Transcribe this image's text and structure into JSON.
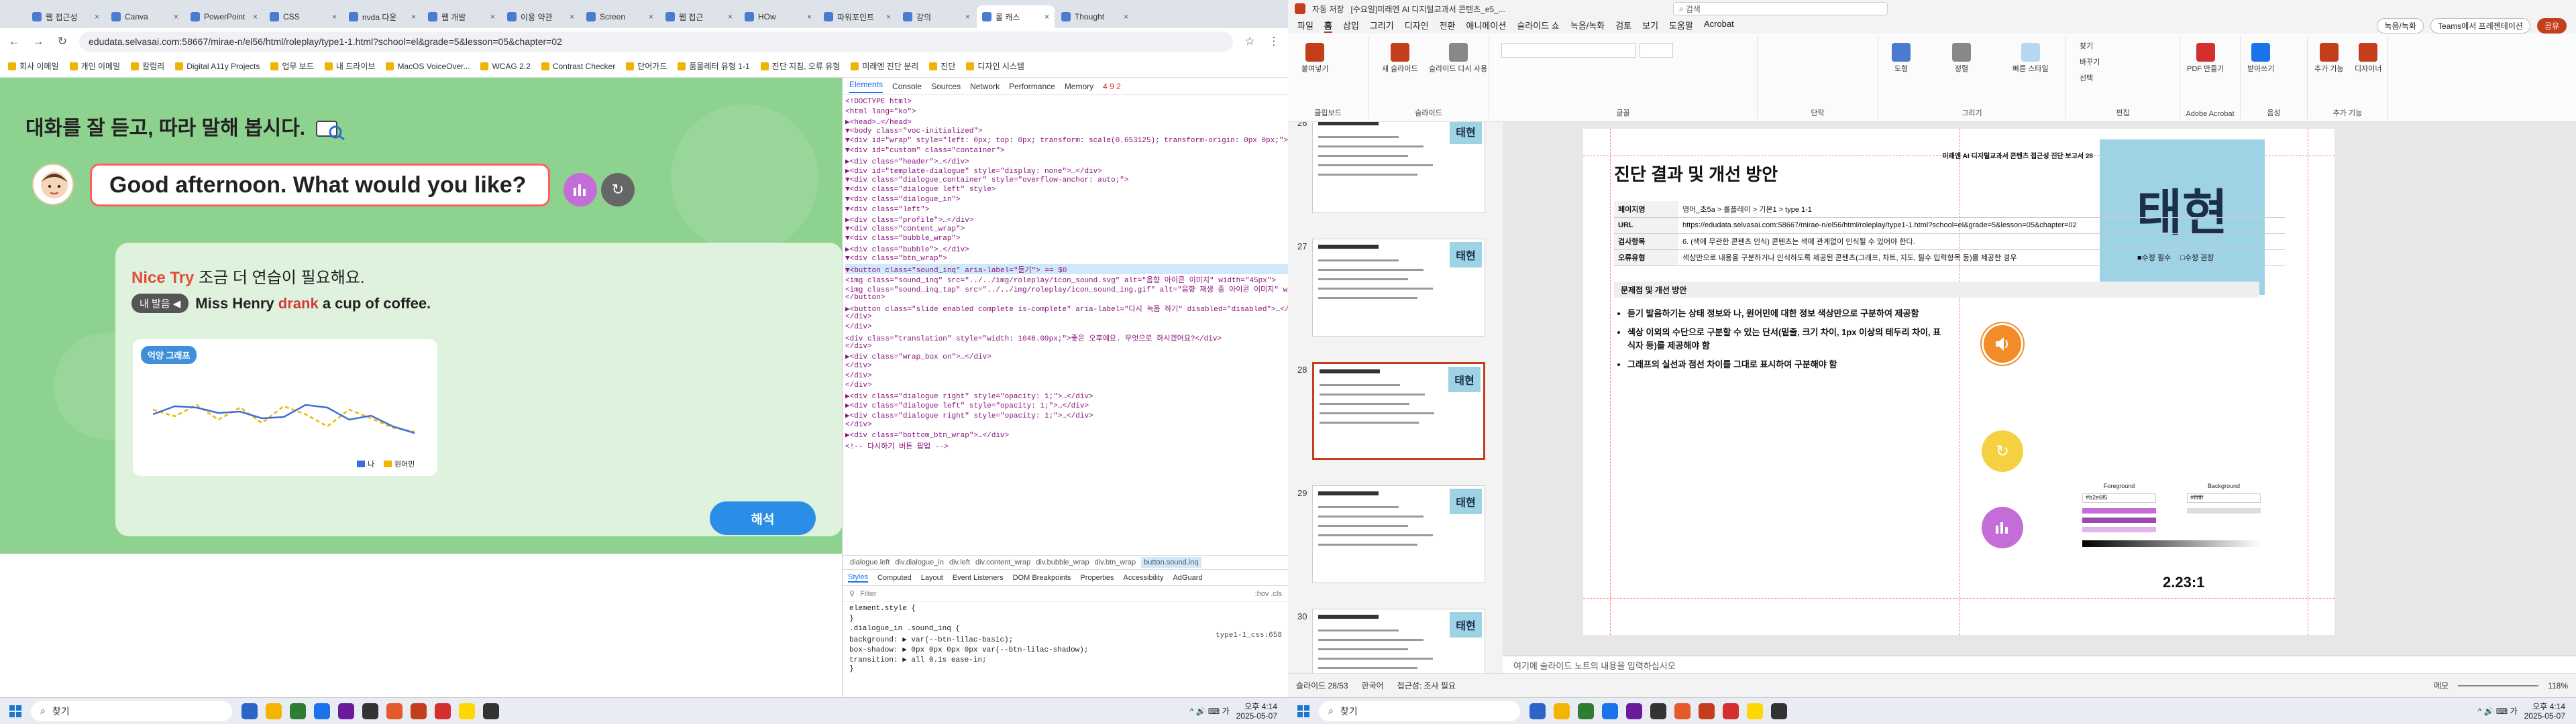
{
  "browser": {
    "tabs": [
      "웹 접근성",
      "Canva",
      "PowerPoint",
      "CSS",
      "nvda 다운",
      "웹 개발",
      "이용 약관",
      "Screen",
      "웹 접근",
      "HOw",
      "파워포인트",
      "강의",
      "롤 캐스",
      "Thought"
    ],
    "active_tab_index": 12,
    "url": "edudata.selvasai.com:58667/mirae-n/el56/html/roleplay/type1-1.html?school=el&grade=5&lesson=05&chapter=02",
    "bookmarks": [
      "회사 이메일",
      "개인 이메일",
      "칼럼리",
      "Digital A11y Projects",
      "업무 보드",
      "내 드라이브",
      "MacOS VoiceOver...",
      "WCAG 2.2",
      "Contrast Checker",
      "단어가드",
      "품몰레터 유형 1-1",
      "진단 지침, 오류 유형",
      "미래엔 진단 분리",
      "진단",
      "디자인 시스템"
    ]
  },
  "lesson": {
    "instruction": "대화를 잘 듣고, 따라 말해 봅시다.",
    "bubble_text": "Good afternoon. What would you like?",
    "result_nice": "Nice Try",
    "result_msg": "조금 더 연습이 필요해요.",
    "my_voice_label": "내 발음 ◀",
    "sentence_a": "Miss Henry ",
    "sentence_err": "drank",
    "sentence_b": " a cup of coffee.",
    "graph_title": "억양 그래프",
    "legend_me": "나",
    "legend_native": "원어민",
    "translate_button": "해석",
    "graph_series": {
      "native": [
        0.55,
        0.45,
        0.62,
        0.4,
        0.58,
        0.35,
        0.6,
        0.48,
        0.3,
        0.55,
        0.42,
        0.28,
        0.22
      ],
      "me": [
        0.48,
        0.6,
        0.58,
        0.5,
        0.52,
        0.42,
        0.44,
        0.62,
        0.58,
        0.4,
        0.46,
        0.3,
        0.2
      ]
    },
    "colors": {
      "native": "#f5b400",
      "me": "#3b6fd8"
    }
  },
  "devtools": {
    "tabs": [
      "Elements",
      "Console",
      "Sources",
      "Network",
      "Performance",
      "Memory"
    ],
    "errors": "4 9 2",
    "dom_lines": [
      "<!DOCTYPE html>",
      "<html lang=\"ko\">",
      "  ▶<head>…</head>",
      "  ▼<body class=\"voc-initialized\">",
      "    ▼<div id=\"wrap\" style=\"left: 0px; top: 0px; transform: scale(0.653125); transform-origin: 0px 0px;\">",
      "      ▼<div id=\"custom\" class=\"container\">",
      "        ▶<div class=\"header\">…</div>",
      "        ▶<div id=\"template-dialogue\" style=\"display: none\">…</div>",
      "        ▼<div class=\"dialogue_container\" style=\"overflow-anchor: auto;\">",
      "          ▼<div class=\"dialogue left\" style>",
      "            ▼<div class=\"dialogue_in\">",
      "              ▼<div class=\"left\">",
      "                ▶<div class=\"profile\">…</div>",
      "                ▼<div class=\"content_wrap\">",
      "                  ▼<div class=\"bubble_wrap\">",
      "                    ▶<div class=\"bubble\">…</div>",
      "                    ▼<div class=\"btn_wrap\">",
      "                      ▼<button class=\"sound_inq\" aria-label=\"듣기\"> == $0",
      "                          <img class=\"sound_inq\" src=\"../../img/roleplay/icon_sound.svg\" alt=\"음향 아이콘 이미지\" width=\"45px\">",
      "                          <img class=\"sound_inq_tap\" src=\"../../img/roleplay/icon_sound_ing.gif\" alt=\"음향 재생 중 아이콘 이미지\" width=\"45px\">",
      "                        </button>",
      "                      ▶<button class=\"slide enabled complete is-complete\" aria-label=\"다시 녹음 하기\" disabled=\"disabled\">…</button>",
      "                    </div>",
      "                  </div>",
      "                  <div class=\"translation\" style=\"width: 1046.09px;\">좋은 오후예요. 무엇으로 하시겠어요?</div>",
      "                </div>",
      "              ▶<div class=\"wrap_box on\">…</div>",
      "              </div>",
      "            </div>",
      "          </div>",
      "          ▶<div class=\"dialogue right\" style=\"opacity: 1;\">…</div>",
      "          ▶<div class=\"dialogue left\" style=\"opacity: 1;\">…</div>",
      "          ▶<div class=\"dialogue right\" style=\"opacity: 1;\">…</div>",
      "        </div>",
      "        ▶<div class=\"bottom_btn_wrap\">…</div>",
      "        <!-- 다시하기 버튼 팝업 -->"
    ],
    "breadcrumb": [
      ".dialogue.left",
      "div.dialogue_in",
      "div.left",
      "div.content_wrap",
      "div.bubble_wrap",
      "div.btn_wrap",
      "button.sound.inq"
    ],
    "style_tabs": [
      "Styles",
      "Computed",
      "Layout",
      "Event Listeners",
      "DOM Breakpoints",
      "Properties",
      "Accessibility",
      "AdGuard"
    ],
    "filter_placeholder": "Filter",
    "filter_right": ":hov .cls",
    "style_lines": [
      "element.style {",
      "}",
      ".dialogue_in .sound_inq {",
      "  background: ▶ var(--btn-lilac-basic);",
      "  box-shadow: ▶ 0px 0px 0px 0px var(--btn-lilac-shadow);",
      "  transition: ▶ all 0.1s ease-in;",
      "}"
    ],
    "style_source": "type1-1_css:658"
  },
  "taskbar_left": {
    "search": "찾기",
    "time": "오후 4:14",
    "date": "2025-05-07"
  },
  "taskbar_right": {
    "search": "찾기",
    "time": "오후 4:14",
    "date": "2025-05-07"
  },
  "ppt": {
    "autosave": "자동 저장",
    "filename": "[수요일]미래엔 AI 디지털교과서 콘텐츠_e5_...",
    "search": "검색",
    "menus": [
      "파일",
      "홈",
      "삽입",
      "그리기",
      "디자인",
      "전환",
      "애니메이션",
      "슬라이드 쇼",
      "녹음/녹화",
      "검토",
      "보기",
      "도움말",
      "Acrobat"
    ],
    "menu_active": 1,
    "record_btn": "녹음/녹화",
    "teams_btn": "Teams에서 프레젠테이션",
    "share_btn": "공유",
    "ribbon_groups": [
      "클립보드",
      "슬라이드",
      "글꼴",
      "단락",
      "그리기",
      "편집",
      "Adobe Acrobat",
      "음성",
      "추가 기능"
    ],
    "ribbon_buttons": [
      "붙여넣기",
      "새 슬라이드",
      "슬라이드 다시 사용",
      "도형",
      "정렬",
      "빠른 스타일",
      "찾기",
      "바꾸기",
      "선택",
      "PDF 만들기",
      "받아쓰기",
      "추가 기능",
      "디자이너"
    ],
    "slide_numbers": [
      26,
      27,
      28,
      29,
      30
    ],
    "selected_slide": 28,
    "slide": {
      "header": "미래엔 AI 디지털교과서 콘텐츠 접근성 진단 보고서  28",
      "title": "진단 결과 및 개선 방안",
      "badge": "태현",
      "check1": "■수정 필수",
      "check2": "□수정 권장",
      "rows": [
        [
          "페이지명",
          "영어_초5a > 롤플레이 > 기본1 > type 1-1"
        ],
        [
          "URL",
          "https://edudata.selvasai.com:58667/mirae-n/el56/html/roleplay/type1-1.html?school=el&grade=5&lesson=05&chapter=02"
        ],
        [
          "검사항목",
          "6. (색에 무관한 콘텐츠 인식) 콘텐츠는 색에 관계없이 인식될 수 있어야 한다."
        ],
        [
          "오류유형",
          "색상만으로 내용을 구분하거나 인식하도록 제공된 콘텐츠(그래프, 차트, 지도, 필수 입력항목 등)를 제공한 경우"
        ]
      ],
      "section": "문제점 및 개선 방안",
      "bullets": [
        "듣기 발음하기는 상태 정보와 나, 원어민에 대한 정보 색상만으로 구분하여 제공함",
        "색상 이외의 수단으로 구분할 수 있는 단서(밑줄, 크기 차이, 1px 이상의 테두리 차이, 표식자 등)를 제공해야 함",
        "그래프의 실선과 점선 차이를 그대로 표시하여 구분해야 함"
      ],
      "contrast_ratio": "2.23:1",
      "contrast_fg": "Foreground",
      "contrast_bg": "Background",
      "contrast_fg_hex": "#b2e6f5",
      "contrast_bg_hex": "#ffffff"
    },
    "notes": "여기에 슬라이드 노트의 내용을 입력하십시오",
    "status_left": "슬라이드 28/53",
    "status_lang": "한국어",
    "status_access": "접근성: 조사 필요",
    "status_notes": "메모",
    "zoom": "118%"
  }
}
